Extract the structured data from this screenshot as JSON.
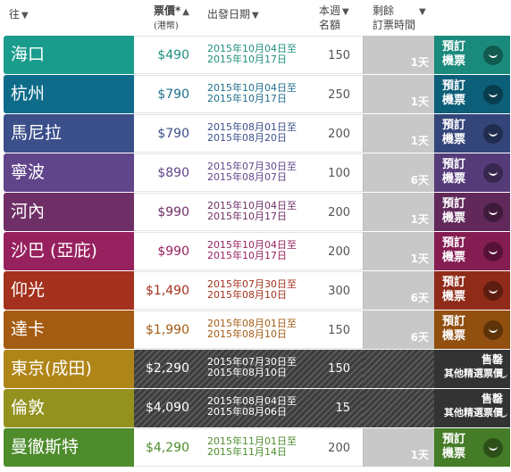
{
  "header": {
    "dest": "往",
    "price": "票價*",
    "price_sub": "(港幣)",
    "date": "出發日期",
    "quota": "本週",
    "quota2": "名額",
    "remain": "剩餘",
    "remain2": "訂票時間",
    "arrow_down": "▼",
    "arrow_up": "▲"
  },
  "rows": [
    {
      "dest": "海口",
      "price": "$490",
      "date1": "2015年10月04日至",
      "date2": "2015年10月17日",
      "quota": "150",
      "days": "1天",
      "status": "book",
      "label1": "預訂",
      "label2": "機票",
      "color": "#1a9c8d",
      "dark": "#1a8a7c",
      "textcolor": "#1f8f7e"
    },
    {
      "dest": "杭州",
      "price": "$790",
      "date1": "2015年10月04日至",
      "date2": "2015年10月17日",
      "quota": "250",
      "days": "1天",
      "status": "book",
      "label1": "預訂",
      "label2": "機票",
      "color": "#0e6c8a",
      "dark": "#0d5e78",
      "textcolor": "#1f6f8a"
    },
    {
      "dest": "馬尼拉",
      "price": "$790",
      "date1": "2015年08月01日至",
      "date2": "2015年08月20日",
      "quota": "200",
      "days": "1天",
      "status": "book",
      "label1": "預訂",
      "label2": "機票",
      "color": "#3b4f8a",
      "dark": "#34457a",
      "textcolor": "#3b4f8a"
    },
    {
      "dest": "寧波",
      "price": "$890",
      "date1": "2015年07月30日至",
      "date2": "2015年08月07日",
      "quota": "100",
      "days": "6天",
      "status": "book",
      "label1": "預訂",
      "label2": "機票",
      "color": "#61458a",
      "dark": "#553c79",
      "textcolor": "#61458a"
    },
    {
      "dest": "河內",
      "price": "$990",
      "date1": "2015年10月04日至",
      "date2": "2015年10月17日",
      "quota": "200",
      "days": "1天",
      "status": "book",
      "label1": "預訂",
      "label2": "機票",
      "color": "#6e2f66",
      "dark": "#61295a",
      "textcolor": "#6e2f66"
    },
    {
      "dest": "沙巴 (亞庇)",
      "price": "$990",
      "date1": "2015年10月04日至",
      "date2": "2015年10月17日",
      "quota": "200",
      "days": "1天",
      "status": "book",
      "label1": "預訂",
      "label2": "機票",
      "color": "#97215e",
      "dark": "#851d53",
      "textcolor": "#97215e"
    },
    {
      "dest": "仰光",
      "price": "$1,490",
      "date1": "2015年07月30日至",
      "date2": "2015年08月10日",
      "quota": "300",
      "days": "6天",
      "status": "book",
      "label1": "預訂",
      "label2": "機票",
      "color": "#a3311d",
      "dark": "#902b19",
      "textcolor": "#a3311d"
    },
    {
      "dest": "達卡",
      "price": "$1,990",
      "date1": "2015年08月01日至",
      "date2": "2015年08月10日",
      "quota": "150",
      "days": "6天",
      "status": "book",
      "label1": "預訂",
      "label2": "機票",
      "color": "#a45b12",
      "dark": "#914f10",
      "textcolor": "#a45b12"
    },
    {
      "dest": "東京(成田)",
      "price": "$2,290",
      "date1": "2015年07月30日至",
      "date2": "2015年08月10日",
      "quota": "150",
      "days": "",
      "status": "sold",
      "label1": "售罄",
      "label2": "其他精選票價",
      "color": "#b08518",
      "dark": "#333",
      "textcolor": "#ffffff"
    },
    {
      "dest": "倫敦",
      "price": "$4,090",
      "date1": "2015年08月04日至",
      "date2": "2015年08月06日",
      "quota": "15",
      "days": "",
      "status": "sold",
      "label1": "售罄",
      "label2": "其他精選票價",
      "color": "#93921f",
      "dark": "#333",
      "textcolor": "#ffffff"
    },
    {
      "dest": "曼徹斯特",
      "price": "$4,290",
      "date1": "2015年11月01日至",
      "date2": "2015年11月14日",
      "quota": "200",
      "days": "1天",
      "status": "book",
      "label1": "預訂",
      "label2": "機票",
      "color": "#4e8c2c",
      "dark": "#457c27",
      "textcolor": "#4e8c2c"
    }
  ]
}
